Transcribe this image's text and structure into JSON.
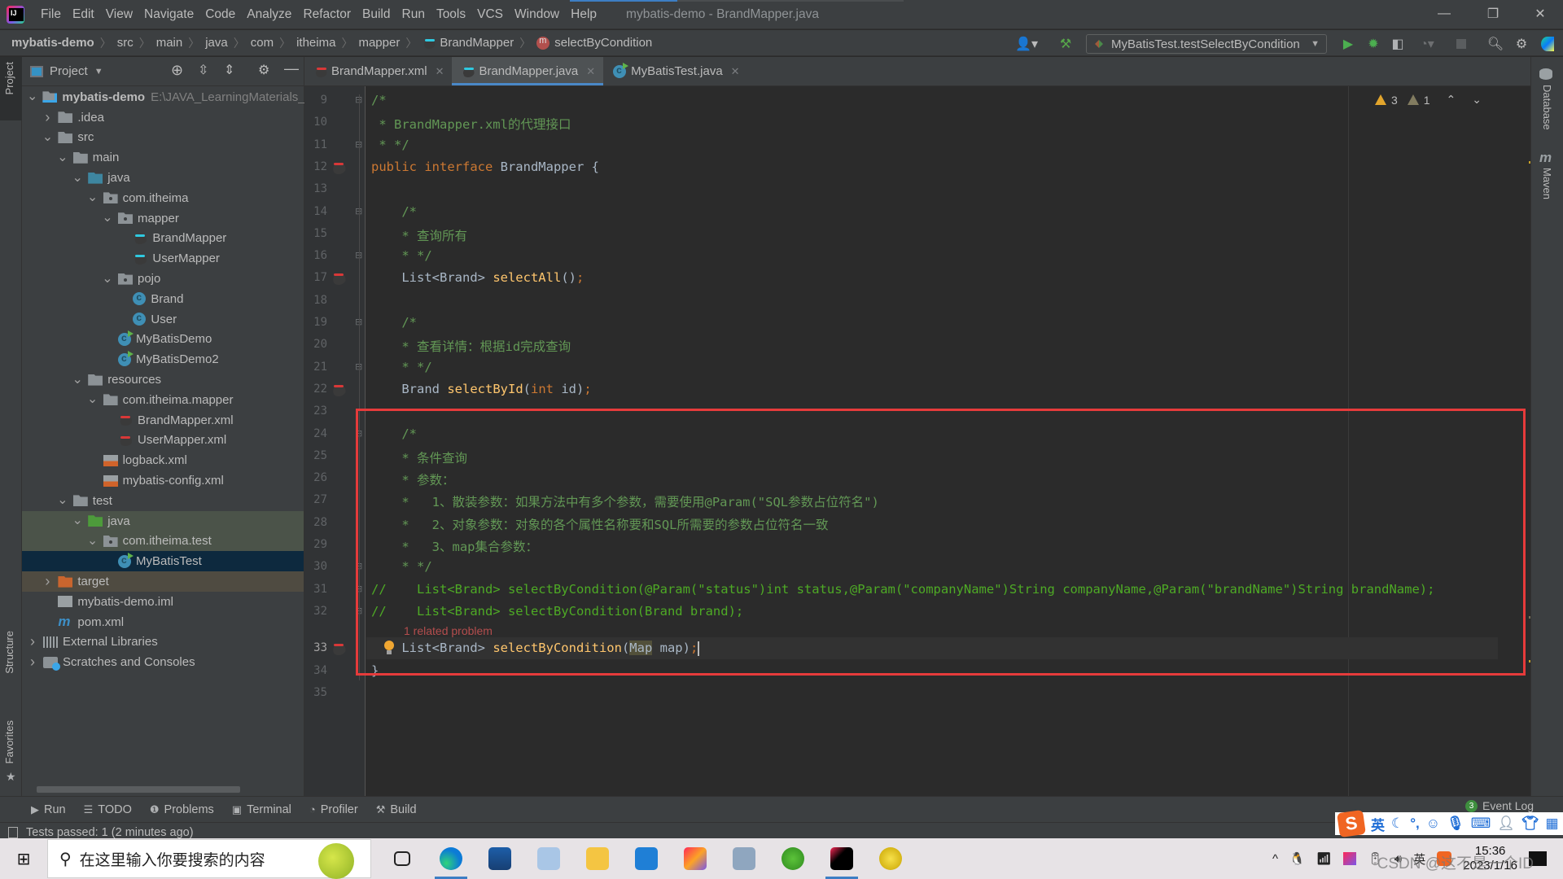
{
  "titlebar": {
    "menu": [
      "File",
      "Edit",
      "View",
      "Navigate",
      "Code",
      "Analyze",
      "Refactor",
      "Build",
      "Run",
      "Tools",
      "VCS",
      "Window",
      "Help"
    ],
    "window_title": "mybatis-demo - BrandMapper.java",
    "controls": {
      "minimize": "—",
      "restore": "❐",
      "close": "✕"
    }
  },
  "breadcrumb": {
    "items": [
      "mybatis-demo",
      "src",
      "main",
      "java",
      "com",
      "itheima",
      "mapper",
      "BrandMapper",
      "selectByCondition"
    ]
  },
  "toolbar": {
    "run_config": "MyBatisTest.testSelectByCondition",
    "icons": [
      "user-icon",
      "build-hammer-icon",
      "run-icon",
      "debug-icon",
      "coverage-icon",
      "profiler-icon",
      "stop-icon",
      "search-icon",
      "settings-icon",
      "toolbox-icon"
    ]
  },
  "left_stripe": {
    "project": "Project",
    "structure": "Structure",
    "favorites": "Favorites"
  },
  "right_stripe": {
    "database": "Database",
    "maven": "Maven"
  },
  "project_panel": {
    "title": "Project",
    "tree": [
      {
        "label": "mybatis-demo",
        "extra": "E:\\JAVA_LearningMaterials_",
        "depth": 0,
        "chev": "open",
        "icon": "module",
        "bold": true
      },
      {
        "label": ".idea",
        "depth": 1,
        "chev": "closed",
        "icon": "folder"
      },
      {
        "label": "src",
        "depth": 1,
        "chev": "open",
        "icon": "folder"
      },
      {
        "label": "main",
        "depth": 2,
        "chev": "open",
        "icon": "folder"
      },
      {
        "label": "java",
        "depth": 3,
        "chev": "open",
        "icon": "folder-blue"
      },
      {
        "label": "com.itheima",
        "depth": 4,
        "chev": "open",
        "icon": "package"
      },
      {
        "label": "mapper",
        "depth": 5,
        "chev": "open",
        "icon": "package"
      },
      {
        "label": "BrandMapper",
        "depth": 6,
        "chev": "none",
        "icon": "mapper-java"
      },
      {
        "label": "UserMapper",
        "depth": 6,
        "chev": "none",
        "icon": "mapper-java"
      },
      {
        "label": "pojo",
        "depth": 5,
        "chev": "open",
        "icon": "package"
      },
      {
        "label": "Brand",
        "depth": 6,
        "chev": "none",
        "icon": "class"
      },
      {
        "label": "User",
        "depth": 6,
        "chev": "none",
        "icon": "class"
      },
      {
        "label": "MyBatisDemo",
        "depth": 5,
        "chev": "none",
        "icon": "class-run"
      },
      {
        "label": "MyBatisDemo2",
        "depth": 5,
        "chev": "none",
        "icon": "class-run"
      },
      {
        "label": "resources",
        "depth": 3,
        "chev": "open",
        "icon": "folder-resources"
      },
      {
        "label": "com.itheima.mapper",
        "depth": 4,
        "chev": "open",
        "icon": "folder"
      },
      {
        "label": "BrandMapper.xml",
        "depth": 5,
        "chev": "none",
        "icon": "mapper-xml"
      },
      {
        "label": "UserMapper.xml",
        "depth": 5,
        "chev": "none",
        "icon": "mapper-xml"
      },
      {
        "label": "logback.xml",
        "depth": 4,
        "chev": "none",
        "icon": "xml"
      },
      {
        "label": "mybatis-config.xml",
        "depth": 4,
        "chev": "none",
        "icon": "xml"
      },
      {
        "label": "test",
        "depth": 2,
        "chev": "open",
        "icon": "folder"
      },
      {
        "label": "java",
        "depth": 3,
        "chev": "open",
        "icon": "folder-green",
        "row_bg": "#4b5349"
      },
      {
        "label": "com.itheima.test",
        "depth": 4,
        "chev": "open",
        "icon": "package",
        "row_bg": "#4b5349"
      },
      {
        "label": "MyBatisTest",
        "depth": 5,
        "chev": "none",
        "icon": "class-test",
        "row_bg": "#0d293e",
        "selected": true
      },
      {
        "label": "target",
        "depth": 1,
        "chev": "closed",
        "icon": "folder-orange",
        "row_bg": "#4f4b41"
      },
      {
        "label": "mybatis-demo.iml",
        "depth": 1,
        "chev": "none",
        "icon": "iml"
      },
      {
        "label": "pom.xml",
        "depth": 1,
        "chev": "none",
        "icon": "maven"
      },
      {
        "label": "External Libraries",
        "depth": 0,
        "chev": "closed",
        "icon": "libraries"
      },
      {
        "label": "Scratches and Consoles",
        "depth": 0,
        "chev": "closed",
        "icon": "scratches"
      }
    ]
  },
  "tabs": [
    {
      "label": "BrandMapper.xml",
      "icon": "mapper-xml",
      "active": false
    },
    {
      "label": "BrandMapper.java",
      "icon": "mapper-java",
      "active": true
    },
    {
      "label": "MyBatisTest.java",
      "icon": "class-test",
      "active": false
    }
  ],
  "editor": {
    "inspections": {
      "warnings": "3",
      "weak_warnings": "1"
    },
    "related_problem": "1 related problem",
    "lines": [
      {
        "n": "9",
        "gutter": "fold-open",
        "tokens": [
          [
            "cm",
            "/*"
          ]
        ]
      },
      {
        "n": "10",
        "tokens": [
          [
            "cm",
            " * BrandMapper.xml的代理接口"
          ]
        ]
      },
      {
        "n": "11",
        "gutter": "fold-close",
        "tokens": [
          [
            "cm",
            " * */"
          ]
        ]
      },
      {
        "n": "12",
        "gutter": "mapper",
        "tokens": [
          [
            "kw",
            "public interface "
          ],
          [
            "ty",
            "BrandMapper {"
          ]
        ]
      },
      {
        "n": "13",
        "tokens": []
      },
      {
        "n": "14",
        "gutter": "fold-open",
        "tokens": [
          [
            "cm",
            "    /*"
          ]
        ]
      },
      {
        "n": "15",
        "tokens": [
          [
            "cm",
            "    * 查询所有"
          ]
        ]
      },
      {
        "n": "16",
        "gutter": "fold-close",
        "tokens": [
          [
            "cm",
            "    * */"
          ]
        ]
      },
      {
        "n": "17",
        "gutter": "mapper",
        "tokens": [
          [
            "ty",
            "    List<Brand> "
          ],
          [
            "fn",
            "selectAll"
          ],
          [
            "ty",
            "()"
          ],
          [
            "kw",
            ";"
          ]
        ]
      },
      {
        "n": "18",
        "tokens": []
      },
      {
        "n": "19",
        "gutter": "fold-open",
        "tokens": [
          [
            "cm",
            "    /*"
          ]
        ]
      },
      {
        "n": "20",
        "tokens": [
          [
            "cm",
            "    * 查看详情：根据id完成查询"
          ]
        ]
      },
      {
        "n": "21",
        "gutter": "fold-close",
        "tokens": [
          [
            "cm",
            "    * */"
          ]
        ]
      },
      {
        "n": "22",
        "gutter": "mapper",
        "tokens": [
          [
            "ty",
            "    Brand "
          ],
          [
            "fn",
            "selectById"
          ],
          [
            "ty",
            "("
          ],
          [
            "kw",
            "int "
          ],
          [
            "ty",
            "id)"
          ],
          [
            "kw",
            ";"
          ]
        ]
      },
      {
        "n": "23",
        "tokens": []
      },
      {
        "n": "24",
        "gutter": "fold-open",
        "tokens": [
          [
            "cm",
            "    /*"
          ]
        ]
      },
      {
        "n": "25",
        "tokens": [
          [
            "cm",
            "    * 条件查询"
          ]
        ]
      },
      {
        "n": "26",
        "tokens": [
          [
            "cm",
            "    * 参数："
          ]
        ]
      },
      {
        "n": "27",
        "tokens": [
          [
            "cm",
            "    *   1、散装参数：如果方法中有多个参数，需要使用@Param(\"SQL参数占位符名\")"
          ]
        ]
      },
      {
        "n": "28",
        "tokens": [
          [
            "cm",
            "    *   2、对象参数：对象的各个属性名称要和SQL所需要的参数占位符名一致"
          ]
        ]
      },
      {
        "n": "29",
        "tokens": [
          [
            "cm",
            "    *   3、map集合参数："
          ]
        ]
      },
      {
        "n": "30",
        "gutter": "fold-close",
        "tokens": [
          [
            "cm",
            "    * */"
          ]
        ]
      },
      {
        "n": "31",
        "gutter": "fold-open",
        "tokens": [
          [
            "cm2",
            "//    List<Brand> selectByCondition(@Param(\"status\")int status,@Param(\"companyName\")String companyName,@Param(\"brandName\")String brandName);"
          ]
        ]
      },
      {
        "n": "32",
        "gutter": "fold-close",
        "tokens": [
          [
            "cm2",
            "//    List<Brand> selectByCondition(Brand brand);"
          ]
        ]
      },
      {
        "n": "33",
        "gutter": "mapper",
        "current": true,
        "tokens": [
          [
            "ty",
            "    List<Brand> "
          ],
          [
            "fn",
            "selectByCondition"
          ],
          [
            "ty",
            "("
          ],
          [
            "hl",
            "Map"
          ],
          [
            "ty",
            " map)"
          ],
          [
            "kw",
            ";"
          ]
        ]
      },
      {
        "n": "34",
        "tokens": [
          [
            "ty",
            "}"
          ]
        ]
      },
      {
        "n": "35",
        "tokens": []
      }
    ]
  },
  "bottom_tools": [
    {
      "label": "Run",
      "icon": "run-icon"
    },
    {
      "label": "TODO",
      "icon": "todo-icon"
    },
    {
      "label": "Problems",
      "icon": "problems-icon"
    },
    {
      "label": "Terminal",
      "icon": "terminal-icon"
    },
    {
      "label": "Profiler",
      "icon": "profiler-icon"
    },
    {
      "label": "Build",
      "icon": "build-icon"
    }
  ],
  "event_log": {
    "count": "3",
    "label": "Event Log"
  },
  "status": {
    "text": "Tests passed: 1 (2 minutes ago)"
  },
  "ime": {
    "lang": "英",
    "icons": [
      "moon",
      "comma",
      "smile",
      "mic",
      "keyboard",
      "user",
      "shirt",
      "grid"
    ]
  },
  "taskbar": {
    "search_placeholder": "在这里输入你要搜索的内容",
    "apps": [
      "task-view",
      "edge",
      "store",
      "app",
      "file-explorer",
      "app-blue",
      "jetbrains-toolbox",
      "network-app",
      "app-green",
      "intellij-idea",
      "app-yellow"
    ],
    "tray": {
      "ime": "英",
      "time": "15:36",
      "date": "2023/1/16"
    },
    "watermark": "CSDN @这不是一个ID"
  },
  "colors": {
    "accent": "#4a88c7",
    "highlight_box": "#e63b3b",
    "comment": "#629755",
    "keyword": "#cc7832",
    "function": "#ffc66d"
  }
}
